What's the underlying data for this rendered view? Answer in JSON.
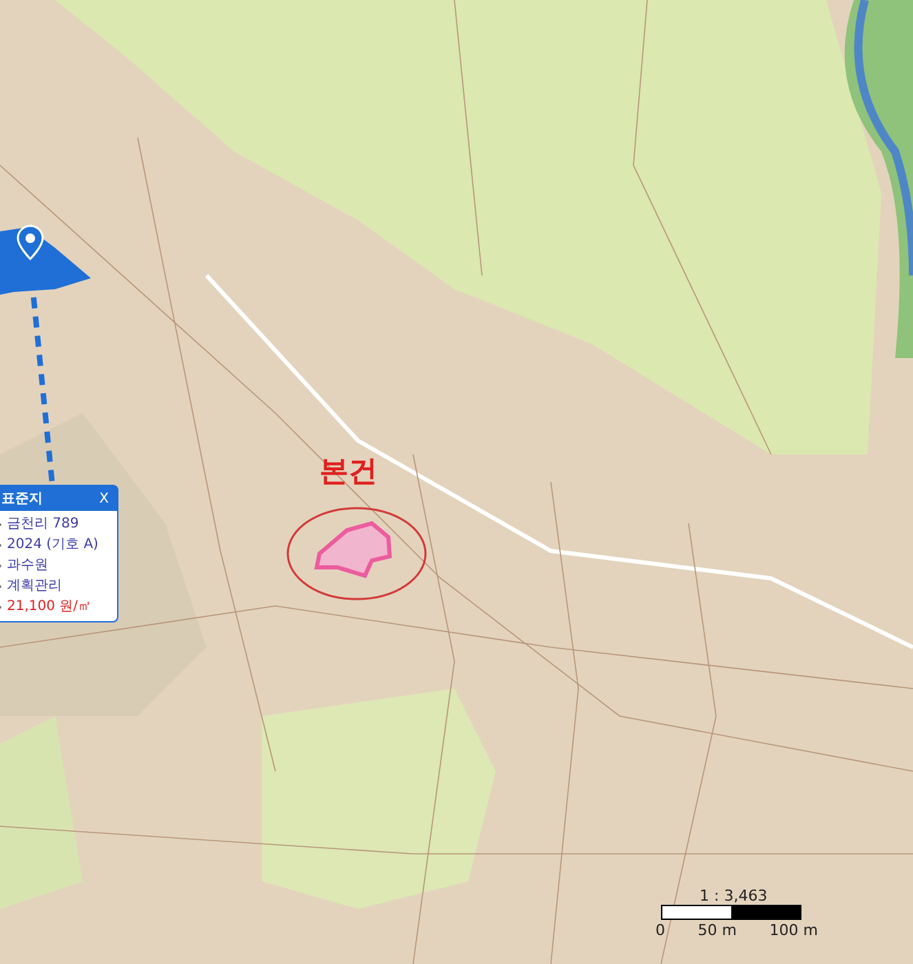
{
  "map": {
    "subject_label": "본건",
    "info_popup": {
      "title": "표준지",
      "close": "X",
      "items": [
        {
          "text": "금천리 789",
          "kind": "plain"
        },
        {
          "text": "2024 (기호 A)",
          "kind": "plain"
        },
        {
          "text": "과수원",
          "kind": "plain"
        },
        {
          "text": "계획관리",
          "kind": "plain"
        },
        {
          "text": "21,100 원/㎡",
          "kind": "price"
        }
      ]
    },
    "scale_bar": {
      "ratio": "1 : 3,463",
      "ticks": [
        "0",
        "50 m",
        "100 m"
      ]
    }
  }
}
